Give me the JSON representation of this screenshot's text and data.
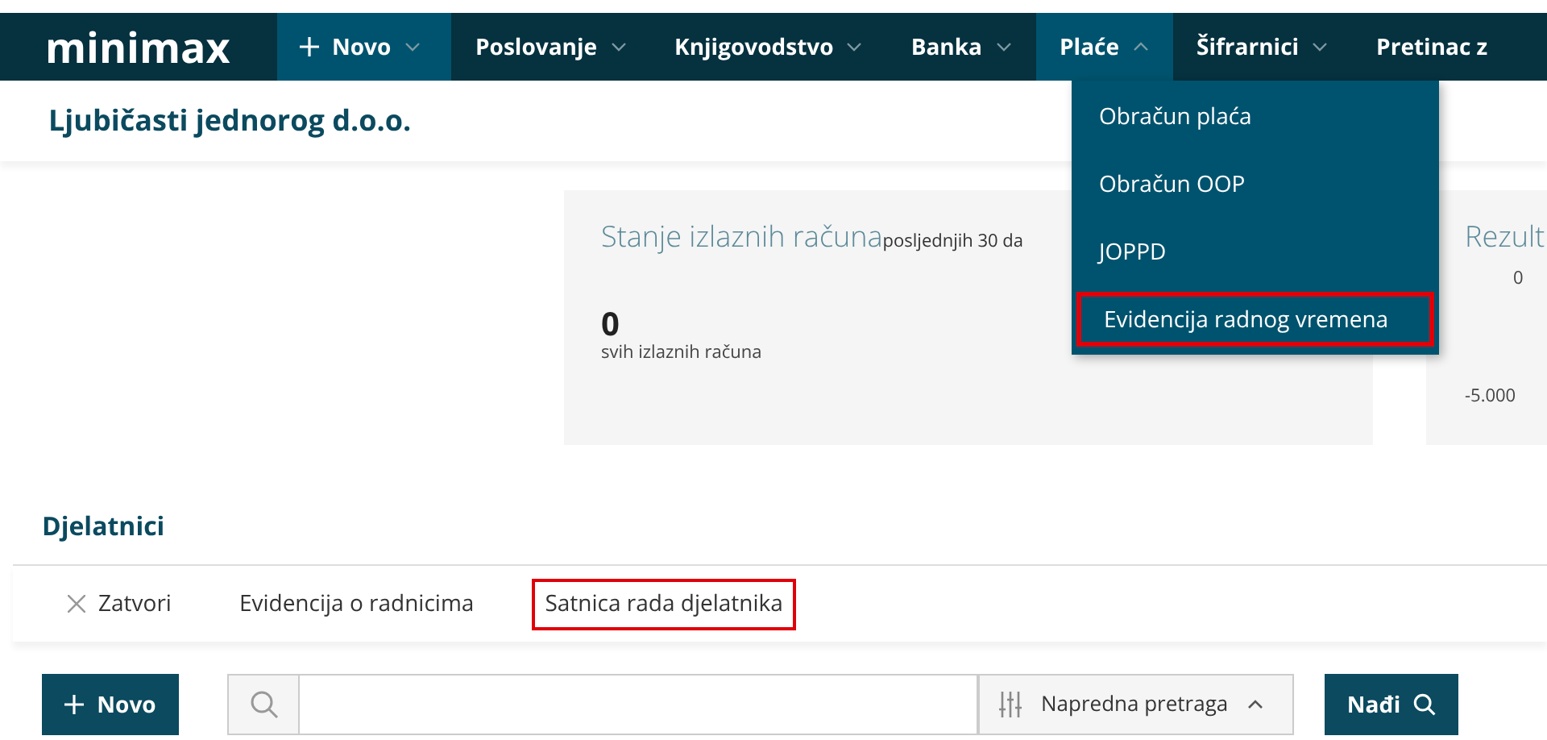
{
  "logo": "minimax",
  "nav": [
    {
      "label": "Novo",
      "kind": "new",
      "selected": false
    },
    {
      "label": "Poslovanje",
      "kind": "menu",
      "selected": false
    },
    {
      "label": "Knjigovodstvo",
      "kind": "menu",
      "selected": false
    },
    {
      "label": "Banka",
      "kind": "menu",
      "selected": false
    },
    {
      "label": "Plaće",
      "kind": "menu",
      "selected": true
    },
    {
      "label": "Šifrarnici",
      "kind": "menu",
      "selected": false
    },
    {
      "label": "Pretinac z",
      "kind": "menu",
      "selected": false
    }
  ],
  "dropdown": [
    {
      "label": "Obračun plaća",
      "highlighted": false
    },
    {
      "label": "Obračun OOP",
      "highlighted": false
    },
    {
      "label": "JOPPD",
      "highlighted": false
    },
    {
      "label": "Evidencija radnog vremena",
      "highlighted": true
    }
  ],
  "company": "Ljubičasti jednorog d.o.o.",
  "card": {
    "title": "Stanje izlaznih računa",
    "subtitle": "posljednjih 30 da",
    "value": "0",
    "caption": "svih izlaznih računa"
  },
  "card2": {
    "title": "Rezult",
    "axis": [
      "0",
      "-5.000"
    ]
  },
  "section": {
    "title": "Djelatnici"
  },
  "toolbar": [
    {
      "label": "Zatvori",
      "kind": "close",
      "highlighted": false
    },
    {
      "label": "Evidencija o radnicima",
      "kind": "link",
      "highlighted": false
    },
    {
      "label": "Satnica rada djelatnika",
      "kind": "link",
      "highlighted": true
    }
  ],
  "actions": {
    "new": "Novo",
    "advanced": "Napredna pretraga",
    "find": "Nađi"
  }
}
